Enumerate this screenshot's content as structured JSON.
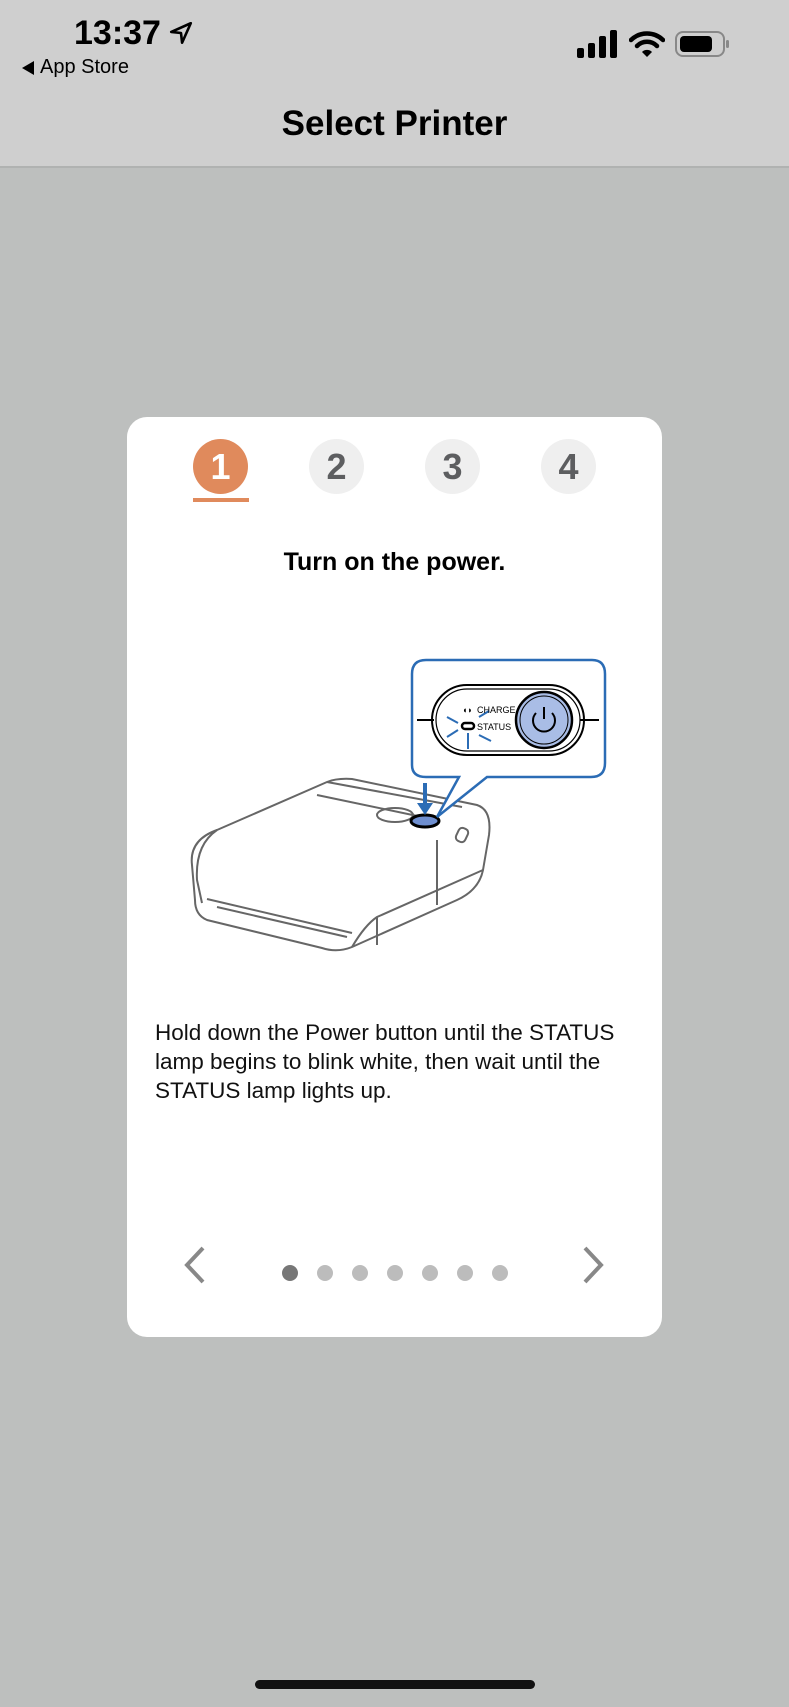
{
  "status_bar": {
    "time": "13:37",
    "back_label": "App Store",
    "icons": [
      "location-arrow-icon",
      "cellular-signal-icon",
      "wifi-icon",
      "battery-icon"
    ]
  },
  "nav": {
    "title": "Select Printer"
  },
  "steps": [
    {
      "label": "1",
      "active": true
    },
    {
      "label": "2",
      "active": false
    },
    {
      "label": "3",
      "active": false
    },
    {
      "label": "4",
      "active": false
    }
  ],
  "step_content": {
    "heading": "Turn on the power.",
    "illustration_labels": {
      "charge": "CHARGE",
      "status": "STATUS"
    },
    "body": "Hold down the Power button until the STATUS lamp begins to blink white, then wait until the STATUS lamp lights up."
  },
  "pager": {
    "page_count": 7,
    "current_page": 1
  },
  "colors": {
    "accent": "#e08a5c",
    "illustration_blue": "#2b6cb5",
    "background": "#bdbfbe"
  }
}
